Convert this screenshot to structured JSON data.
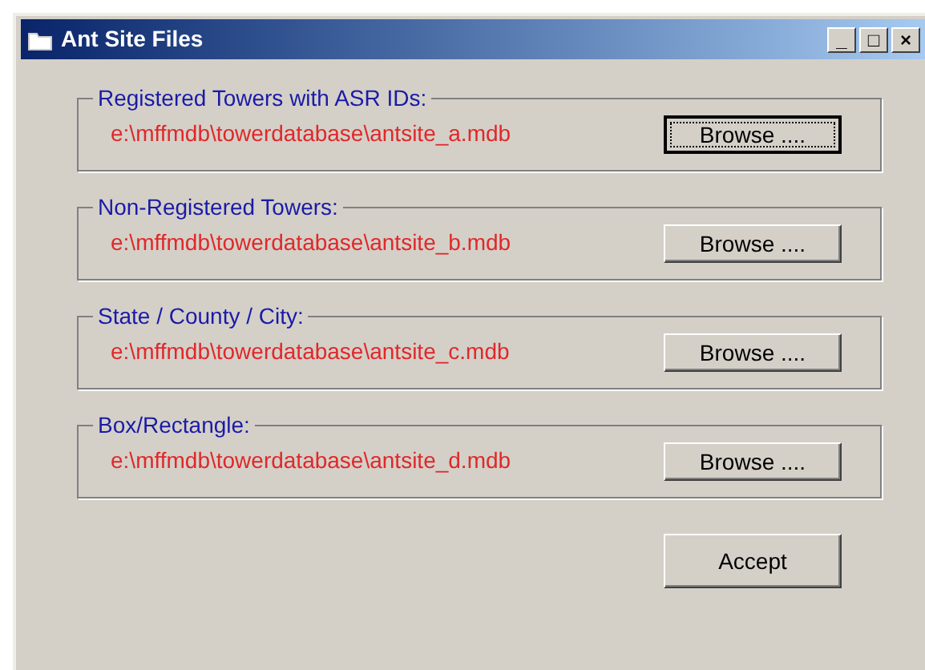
{
  "window": {
    "title": "Ant Site Files",
    "controls": [
      "_",
      "□",
      "×"
    ]
  },
  "groups": [
    {
      "label": "Registered Towers with ASR IDs:",
      "path": "e:\\mffmdb\\towerdatabase\\antsite_a.mdb",
      "button": "Browse ....",
      "focused": true
    },
    {
      "label": "Non-Registered Towers:",
      "path": "e:\\mffmdb\\towerdatabase\\antsite_b.mdb",
      "button": "Browse ....",
      "focused": false
    },
    {
      "label": "State / County / City:",
      "path": "e:\\mffmdb\\towerdatabase\\antsite_c.mdb",
      "button": "Browse ....",
      "focused": false
    },
    {
      "label": "Box/Rectangle:",
      "path": "e:\\mffmdb\\towerdatabase\\antsite_d.mdb",
      "button": "Browse ....",
      "focused": false
    }
  ],
  "accept_button": "Accept"
}
